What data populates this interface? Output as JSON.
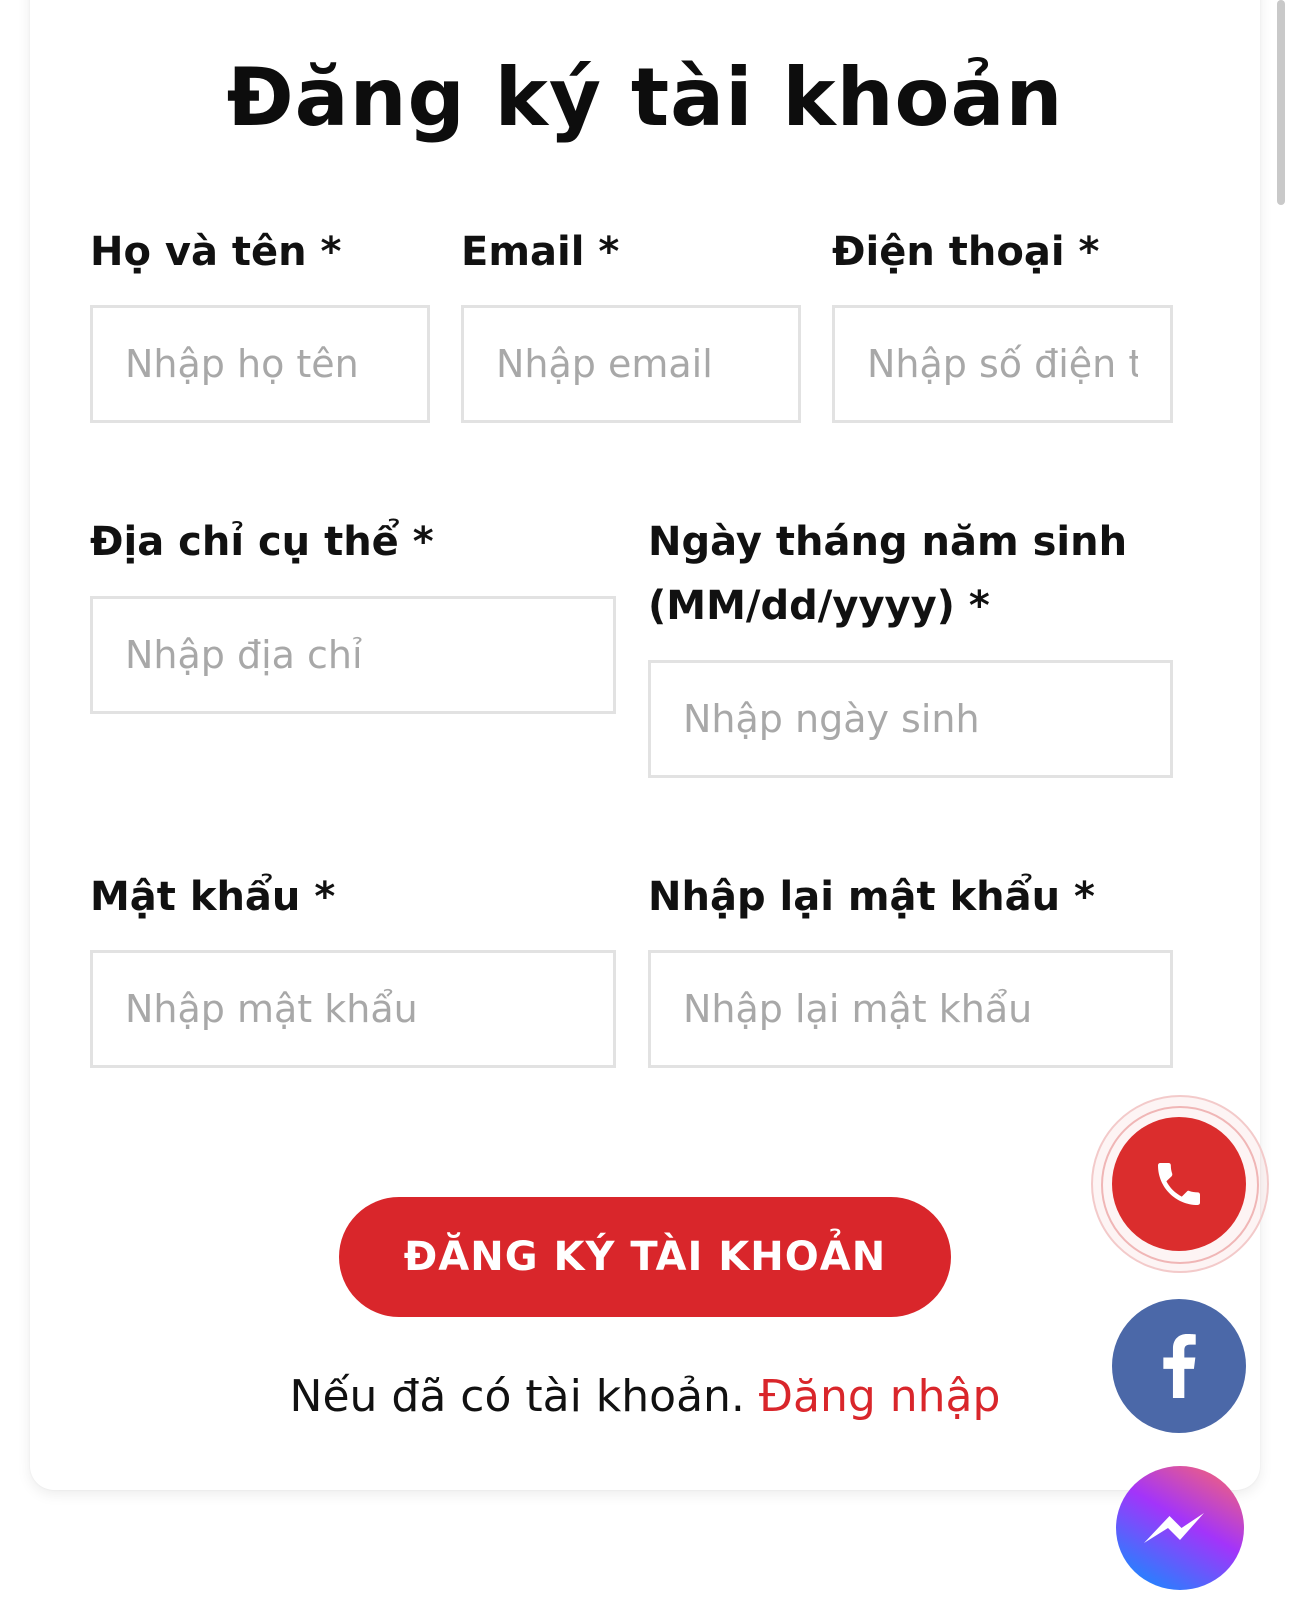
{
  "form": {
    "title": "Đăng ký tài khoản",
    "fields": {
      "fullname": {
        "label": "Họ và tên *",
        "placeholder": "Nhập họ tên"
      },
      "email": {
        "label": "Email *",
        "placeholder": "Nhập email"
      },
      "phone": {
        "label": "Điện thoại *",
        "placeholder": "Nhập số điện thoại"
      },
      "address": {
        "label": "Địa chỉ cụ thể *",
        "placeholder": "Nhập địa chỉ"
      },
      "birthday": {
        "label": "Ngày tháng năm sinh (MM/dd/yyyy) *",
        "placeholder": "Nhập ngày sinh"
      },
      "password": {
        "label": "Mật khẩu *",
        "placeholder": "Nhập mật khẩu"
      },
      "password_confirm": {
        "label": "Nhập lại mật khẩu *",
        "placeholder": "Nhập lại mật khẩu"
      }
    },
    "submit_label": "ĐĂNG KÝ TÀI KHOẢN",
    "login_prompt": "Nếu đã có tài khoản.",
    "login_link": "Đăng nhập"
  },
  "floating_actions": {
    "call": {
      "icon": "phone-icon",
      "color": "#db2d2d"
    },
    "facebook": {
      "icon": "facebook-icon",
      "color": "#4b68a8"
    },
    "messenger": {
      "icon": "messenger-icon"
    }
  },
  "colors": {
    "accent": "#d9262b",
    "input_border": "#e2e2e2",
    "placeholder": "#a8a8a8"
  }
}
